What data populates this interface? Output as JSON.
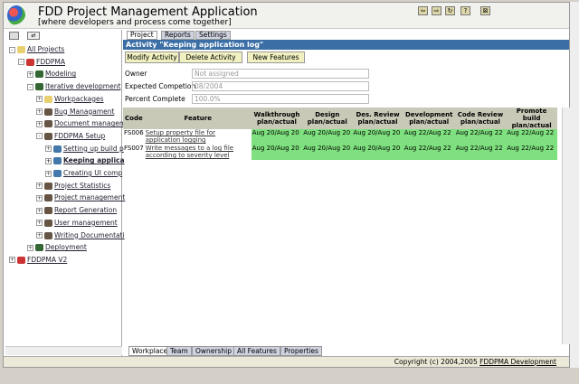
{
  "header": {
    "title": "FDD Project Management Application",
    "subtitle": "[where developers and process come together]"
  },
  "tree": [
    {
      "label": "All Projects",
      "l": 0,
      "pm": "-",
      "c": "#e8d070"
    },
    {
      "label": "FDDPMA",
      "l": 1,
      "pm": "-",
      "c": "#c33"
    },
    {
      "label": "Modeling",
      "l": 2,
      "pm": "+",
      "c": "#363"
    },
    {
      "label": "Iterative development",
      "l": 2,
      "pm": "-",
      "c": "#363"
    },
    {
      "label": "Workpackages",
      "l": 3,
      "pm": "+",
      "c": "#e8d070"
    },
    {
      "label": "Bug Managament",
      "l": 3,
      "pm": "+",
      "c": "#654"
    },
    {
      "label": "Document managem",
      "l": 3,
      "pm": "+",
      "c": "#654"
    },
    {
      "label": "FDDPMA Setup",
      "l": 3,
      "pm": "-",
      "c": "#654"
    },
    {
      "label": "Setting up build p",
      "l": 4,
      "pm": "+",
      "c": "#47a"
    },
    {
      "label": "Keeping applica",
      "l": 4,
      "pm": "+",
      "c": "#47a",
      "bold": true
    },
    {
      "label": "Creating UI comp",
      "l": 4,
      "pm": "+",
      "c": "#47a"
    },
    {
      "label": "Project Statistics",
      "l": 3,
      "pm": "+",
      "c": "#654"
    },
    {
      "label": "Project management",
      "l": 3,
      "pm": "+",
      "c": "#654"
    },
    {
      "label": "Report Generation",
      "l": 3,
      "pm": "+",
      "c": "#654"
    },
    {
      "label": "User management",
      "l": 3,
      "pm": "+",
      "c": "#654"
    },
    {
      "label": "Writing Documentati",
      "l": 3,
      "pm": "+",
      "c": "#654"
    },
    {
      "label": "Deployment",
      "l": 2,
      "pm": "+",
      "c": "#363"
    },
    {
      "label": "FDDPMA V2",
      "l": 0,
      "pm": "+",
      "c": "#c33"
    }
  ],
  "tabs": [
    "Project",
    "Reports",
    "Settings"
  ],
  "activity_title": "Activity \"Keeping application log\"",
  "buttons": {
    "modify": "Modify Activity",
    "delete": "Delete Activity",
    "new": "New Features"
  },
  "fields": {
    "owner_label": "Owner",
    "owner": "Not assigned",
    "exp_label": "Expected Competion",
    "exp": "08/2004",
    "pct_label": "Percent Complete",
    "pct": "100.0%"
  },
  "table": {
    "headers": [
      "Code",
      "Feature",
      "Walkthrough plan/actual",
      "Design plan/actual",
      "Des. Review plan/actual",
      "Development plan/actual",
      "Code Review plan/actual",
      "Promote build plan/actual"
    ],
    "rows": [
      [
        "FS006",
        "Setup property file for application logging",
        "Aug 20/Aug 20",
        "Aug 20/Aug 20",
        "Aug 20/Aug 20",
        "Aug 22/Aug 22",
        "Aug 22/Aug 22",
        "Aug 22/Aug 22"
      ],
      [
        "FS007",
        "Write messages to a log file according to severity level",
        "Aug 20/Aug 20",
        "Aug 20/Aug 20",
        "Aug 20/Aug 20",
        "Aug 22/Aug 22",
        "Aug 22/Aug 22",
        "Aug 22/Aug 22"
      ]
    ]
  },
  "bottom_tabs": [
    "Workplace",
    "Team",
    "Ownership",
    "All Features",
    "Properties"
  ],
  "status": {
    "copyright": "Copyright (c) 2004,2005",
    "link": "FDDPMA Development"
  }
}
